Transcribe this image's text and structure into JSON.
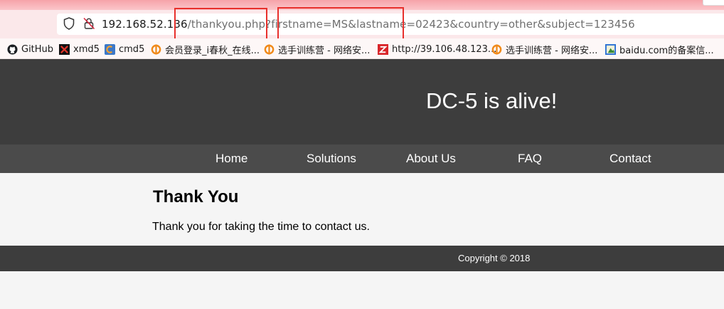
{
  "browser": {
    "url_host": "192.168.52.136",
    "url_rest": "/thankyou.php?firstname=MS&lastname=02423&country=other&subject=123456"
  },
  "bookmarks": [
    {
      "label": "GitHub",
      "icon": "github-icon"
    },
    {
      "label": "xmd5",
      "icon": "xmd5-icon"
    },
    {
      "label": "cmd5",
      "icon": "cmd5-icon"
    },
    {
      "label": "会员登录_i春秋_在线...",
      "icon": "ichunqiu-icon"
    },
    {
      "label": "选手训练营 - 网络安...",
      "icon": "ichunqiu-icon"
    },
    {
      "label": "http://39.106.48.123...",
      "icon": "z-icon"
    },
    {
      "label": "选手训练营 - 网络安...",
      "icon": "ichunqiu-icon"
    },
    {
      "label": "baidu.com的备案信...",
      "icon": "baidu-icon"
    }
  ],
  "site": {
    "title": "DC-5 is alive!",
    "nav": [
      "Home",
      "Solutions",
      "About Us",
      "FAQ",
      "Contact"
    ],
    "heading": "Thank You",
    "message": "Thank you for taking the time to contact us.",
    "copyright": "Copyright © 2018"
  },
  "colors": {
    "header_bg": "#3d3d3d",
    "nav_bg": "#4b4b4b",
    "highlight_box": "#e8302c",
    "top_strip": "#f6a3a9"
  }
}
